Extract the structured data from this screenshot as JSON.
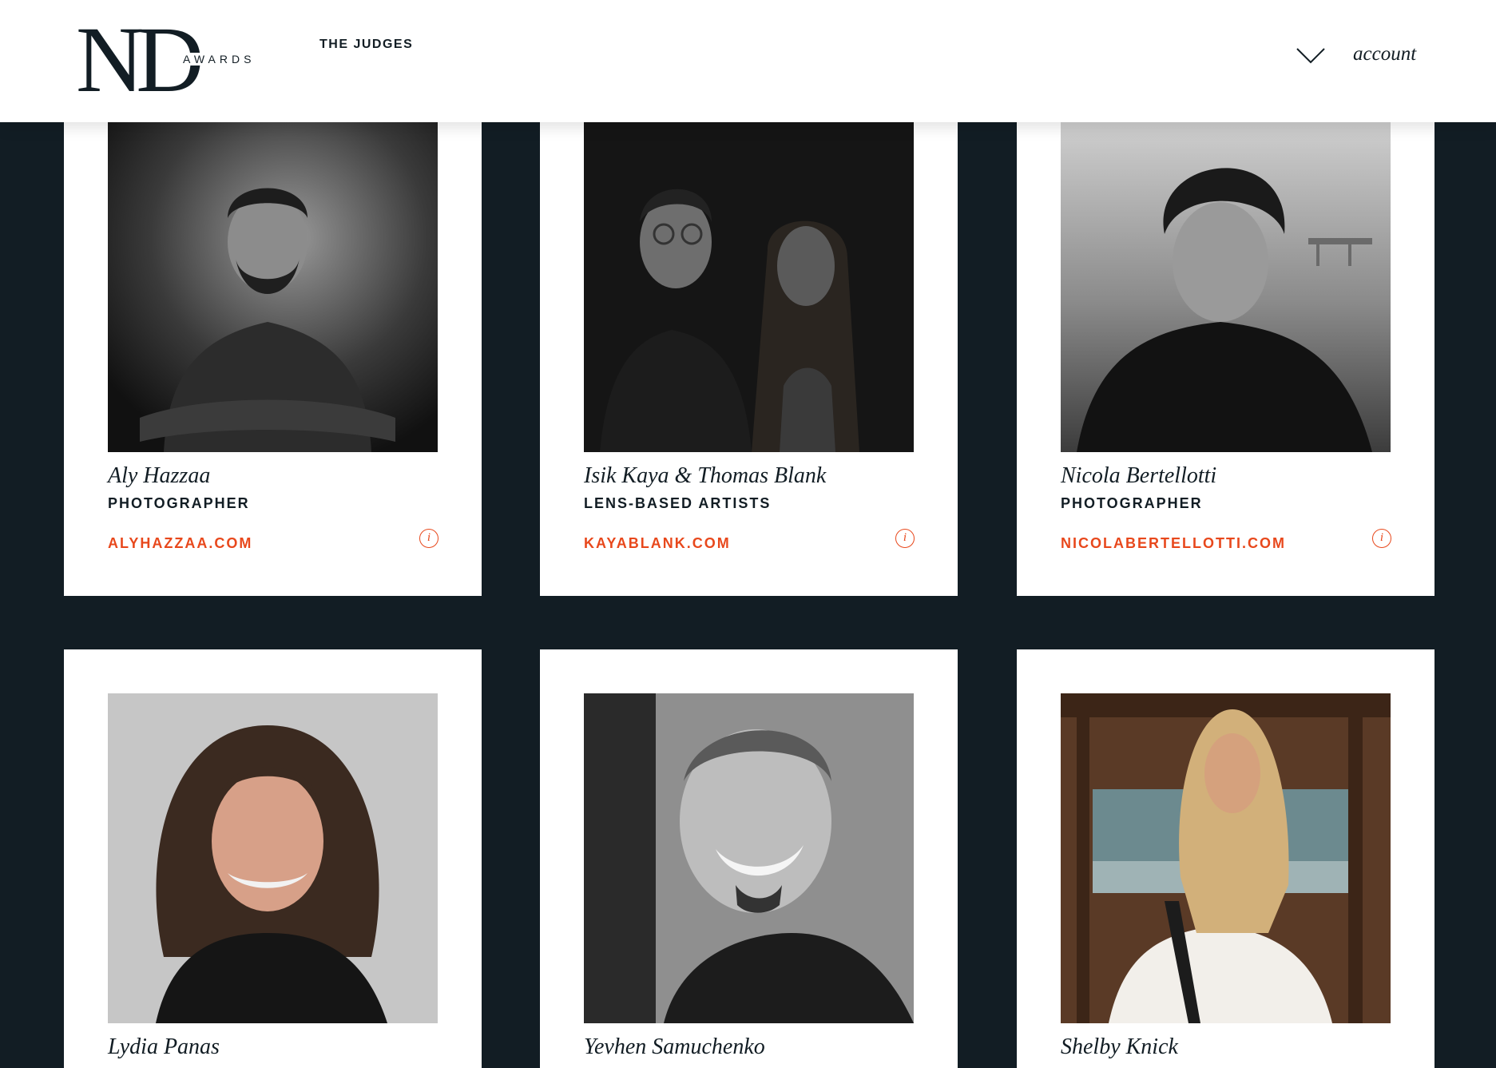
{
  "header": {
    "logo_letters": "ND",
    "logo_sub": "AWARDS",
    "nav_judges": "THE JUDGES",
    "account": "account"
  },
  "judges": [
    {
      "name": "Aly Hazzaa",
      "role": "PHOTOGRAPHER",
      "site": "ALYHAZZAA.COM"
    },
    {
      "name": "Isik Kaya & Thomas Blank",
      "role": "LENS-BASED ARTISTS",
      "site": "KAYABLANK.COM"
    },
    {
      "name": "Nicola Bertellotti",
      "role": "PHOTOGRAPHER",
      "site": "NICOLABERTELLOTTI.COM"
    },
    {
      "name": "Lydia Panas"
    },
    {
      "name": "Yevhen Samuchenko"
    },
    {
      "name": "Shelby Knick"
    }
  ],
  "info_glyph": "i",
  "colors": {
    "background": "#121d24",
    "card": "#ffffff",
    "accent": "#e8481c",
    "text": "#121d24"
  }
}
